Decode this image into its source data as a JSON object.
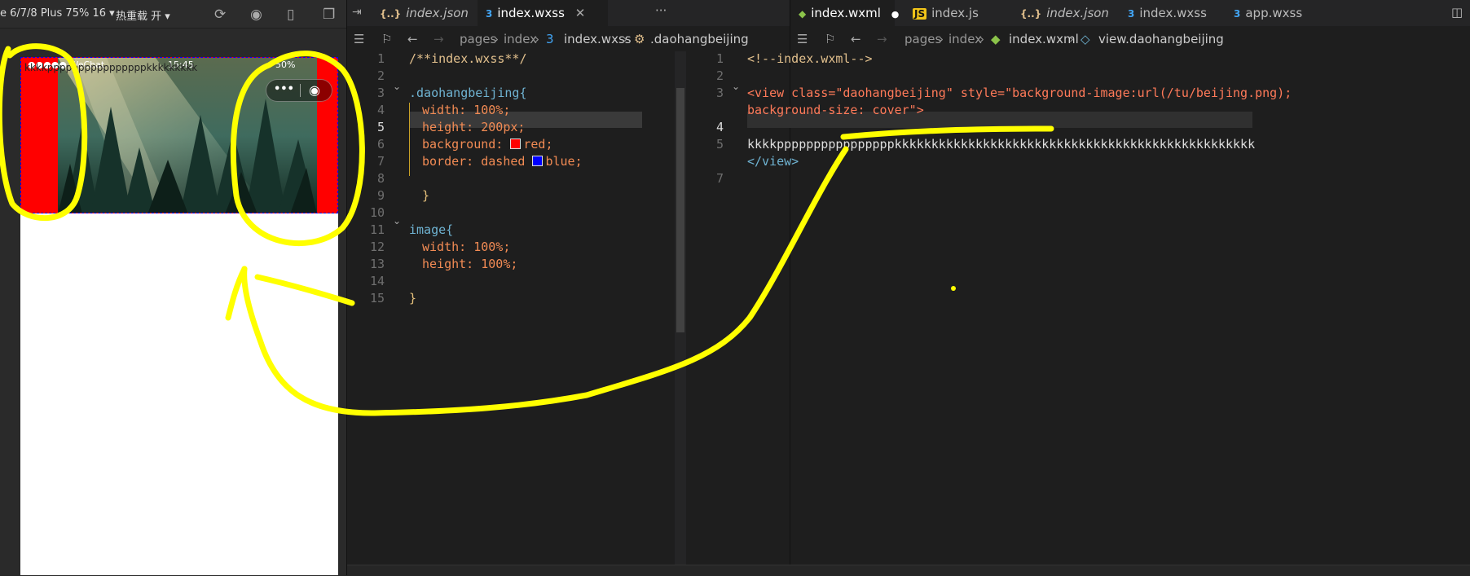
{
  "simulator": {
    "device_label": "e 6/7/8 Plus 75% 16 ▾",
    "hot_reload_label": "热重载 开 ▾",
    "status_left": "●●●●● WeChat",
    "status_time": "15:45",
    "status_right": "50%",
    "content_text": "kkkkppppppppppppppppkkkkkkkkk",
    "icons": [
      "refresh-icon",
      "stop-icon",
      "phone-icon",
      "window-icon",
      "more-dots-icon",
      "record-icon"
    ]
  },
  "left_editor": {
    "tabs": [
      {
        "icon": "{..}",
        "label": "index.json",
        "type": "json",
        "italic": true
      },
      {
        "icon": "css",
        "label": "index.wxss",
        "type": "css",
        "active": true,
        "closable": true
      }
    ],
    "more_label": "···",
    "breadcrumb": [
      "pages",
      "index",
      "index.wxss",
      ".daohangbeijing"
    ],
    "lines": [
      {
        "n": "1",
        "text": "/**index.wxss**/"
      },
      {
        "n": "2",
        "text": ""
      },
      {
        "n": "3",
        "text": ".daohangbeijing{"
      },
      {
        "n": "4",
        "text": "width: 100%;"
      },
      {
        "n": "5",
        "text": "height: 200px;"
      },
      {
        "n": "6",
        "text": "background: red;"
      },
      {
        "n": "7",
        "text": "border: dashed blue;"
      },
      {
        "n": "8",
        "text": ""
      },
      {
        "n": "9",
        "text": "}"
      },
      {
        "n": "10",
        "text": ""
      },
      {
        "n": "11",
        "text": "image{"
      },
      {
        "n": "12",
        "text": "width: 100%;"
      },
      {
        "n": "13",
        "text": "height: 100%;"
      },
      {
        "n": "14",
        "text": ""
      },
      {
        "n": "15",
        "text": "}"
      }
    ]
  },
  "right_editor": {
    "tabs": [
      {
        "icon": "wxml",
        "label": "index.wxml",
        "active": true,
        "modified": true
      },
      {
        "icon": "JS",
        "label": "index.js"
      },
      {
        "icon": "{..}",
        "label": "index.json",
        "italic": true
      },
      {
        "icon": "css",
        "label": "index.wxss"
      },
      {
        "icon": "css",
        "label": "app.wxss"
      }
    ],
    "breadcrumb": [
      "pages",
      "index",
      "index.wxml",
      "view.daohangbeijing"
    ],
    "lines": [
      {
        "n": "1",
        "text": "<!--index.wxml-->"
      },
      {
        "n": "2",
        "text": ""
      },
      {
        "n": "3",
        "text": "<view class=\"daohangbeijing\" style=\"background-image:url(/tu/beijing.png);"
      },
      {
        "n": "",
        "text": "background-size: cover\">"
      },
      {
        "n": "4",
        "text": ""
      },
      {
        "n": "5",
        "text": "kkkkppppppppppppppppkkkkkkkkkkkkkkkkkkkkkkkkkkkkkkkkkkkkkkkkkkkkkkkkk"
      },
      {
        "n": "",
        "text": "</view>"
      },
      {
        "n": "7",
        "text": ""
      }
    ]
  },
  "colors": {
    "accent_annotation": "#ffff00",
    "nav_bg": "#ff0000",
    "nav_border": "#0000ff",
    "editor_bg": "#1e1e1e"
  }
}
